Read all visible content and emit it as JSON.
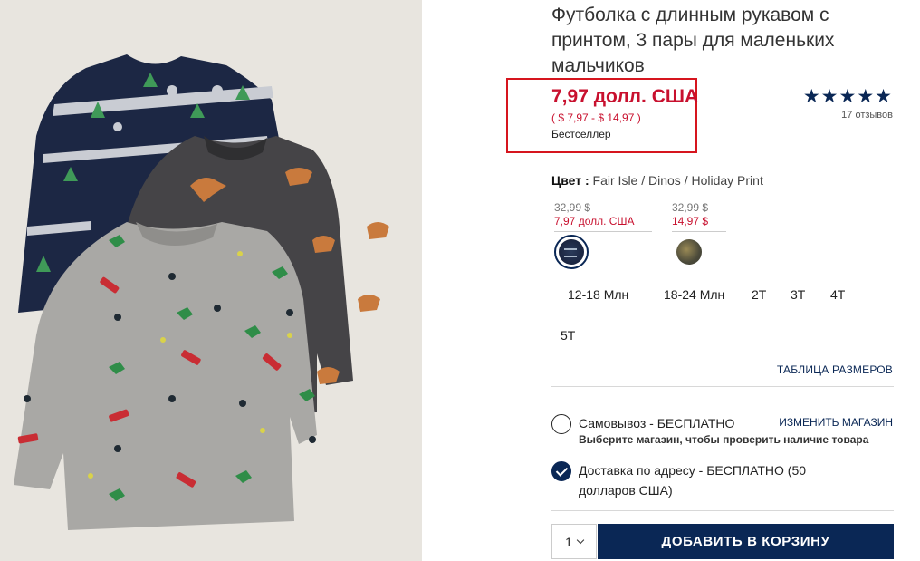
{
  "product": {
    "title": "Футболка с длинным рукавом с принтом, 3 пары для маленьких мальчиков",
    "price": "7,97 долл. США",
    "price_range": "( $ 7,97 - $ 14,97 )",
    "badge": "Бестселлер",
    "rating_stars": "★★★★★",
    "reviews": "17 отзывов"
  },
  "color": {
    "label": "Цвет :",
    "value": " Fair Isle / Dinos / Holiday Print",
    "swatches": [
      {
        "old_price": "32,99 $",
        "new_price": "7,97 долл. США",
        "selected": true
      },
      {
        "old_price": "32,99 $",
        "new_price": "14,97 $",
        "selected": false
      }
    ]
  },
  "sizes": [
    "12-18 Млн",
    "18-24 Млн",
    "2T",
    "3T",
    "4T",
    "5T"
  ],
  "size_chart": "ТАБЛИЦА РАЗМЕРОВ",
  "fulfillment": {
    "pickup_label": "Самовывоз - БЕСПЛАТНО",
    "change_store": "ИЗМЕНИТЬ МАГАЗИН",
    "pickup_note": "Выберите магазин, чтобы проверить наличие товара",
    "delivery_label": "Доставка по адресу - БЕСПЛАТНО (50 долларов США)"
  },
  "cart": {
    "quantity": "1",
    "add_label": "ДОБАВИТЬ В КОРЗИНУ"
  },
  "colors": {
    "navy": "#0a2755",
    "sale_red": "#c8102e",
    "highlight": "#d6151e"
  }
}
